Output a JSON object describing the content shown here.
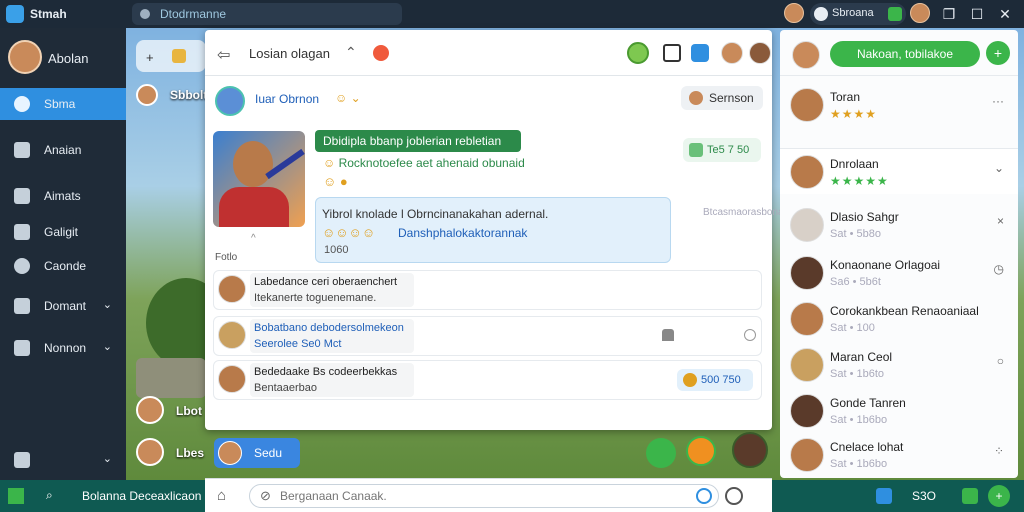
{
  "app": {
    "name": "Stmah"
  },
  "topbar": {
    "search_text": "Dtodrmanne",
    "user_pill": "Sbroana"
  },
  "sidebar": {
    "profile_name": "Abolan",
    "items": [
      {
        "label": "Sbma"
      },
      {
        "label": "Anaian"
      },
      {
        "label": "Aimats"
      },
      {
        "label": "Galigit"
      },
      {
        "label": "Caonde"
      },
      {
        "label": "Domant"
      },
      {
        "label": "Nonnon"
      }
    ]
  },
  "game": {
    "top_widget": "+",
    "player_top": "Sbbolt",
    "players": [
      {
        "label": "Lbot"
      },
      {
        "label": "Lbes"
      }
    ]
  },
  "chat": {
    "title": "Losian olagan",
    "sender_name": "Iuar Obrnon",
    "tag_label": "Sernson",
    "green_bubble": "Dbidipla bbanp joblerian rebletian",
    "line2": "Rocknotoefee aet ahenaid obunaid",
    "badge_right": "Te5 7 50",
    "timestamp": "Btcasmaorasbonal",
    "blue_bubble": {
      "text1": "Yibrol knolade l Obrncinanakahan adernal.",
      "text2": "Danshphalokaktorannak",
      "text3": "1060"
    },
    "below_photo": "^",
    "folder_label": "Fotlo",
    "threads": [
      {
        "line1": "Labedance ceri oberaenchert",
        "line2": "Itekanerte toguenemane."
      },
      {
        "line1": "Bobatbano debodersolmekeon",
        "line2": "Seerolee Se0 Mct"
      },
      {
        "line1": "Bededaake Bs codeerbekkas",
        "line2": "Bentaaerbao",
        "pill": "500 750"
      }
    ]
  },
  "chip": {
    "label": "Sedu"
  },
  "composer": {
    "placeholder": "Berganaan Canaak."
  },
  "friends": {
    "cta_label": "Nakoan, tobilakoe",
    "list": [
      {
        "name": "Toran",
        "rating": "★★★★",
        "action": "···"
      },
      {
        "name": "Dnrolaan",
        "rating": "★★★★★",
        "action": "⌄"
      },
      {
        "name": "Dlasio Sahgr",
        "sub": "Sat • 5b8o",
        "action": "×"
      },
      {
        "name": "Konaonane Orlagoai",
        "sub": "Sa6 • 5b6t",
        "action": "◷"
      },
      {
        "name": "Corokankbean Renaoaniaal",
        "sub": "Sat • 100",
        "action": ""
      },
      {
        "name": "Maran Ceol",
        "sub": "Sat • 1b6to",
        "action": "○"
      },
      {
        "name": "Gonde Tanren",
        "sub": "Sat • 1b6bo",
        "action": ""
      },
      {
        "name": "Cnelace lohat",
        "sub": "Sat • 1b6bo",
        "action": "⁘"
      }
    ]
  },
  "taskbar": {
    "text": "Bolanna Deceaxlicaon",
    "tray_text": "S3O"
  }
}
